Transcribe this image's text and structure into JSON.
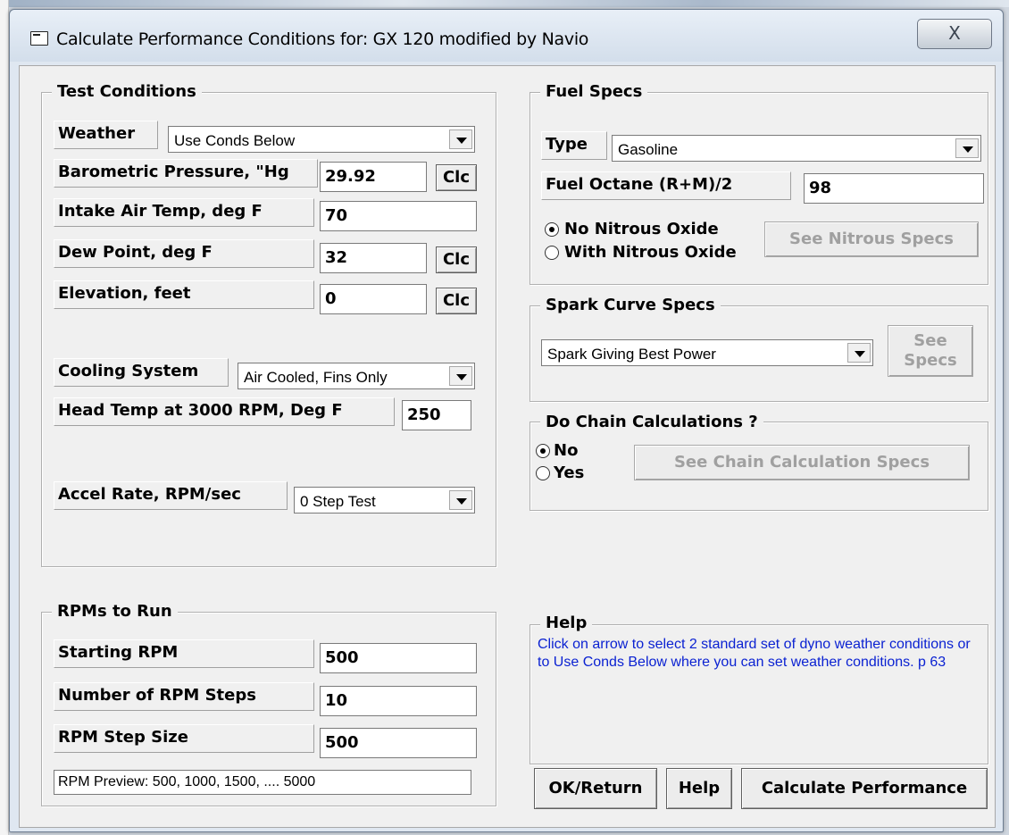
{
  "window": {
    "title": "Calculate Performance Conditions for: GX 120 modified by Navio",
    "close_label": "X"
  },
  "test_conditions": {
    "legend": "Test Conditions",
    "weather_label": "Weather",
    "weather_value": "Use Conds Below",
    "baro_label": "Barometric Pressure, \"Hg",
    "baro_value": "29.92",
    "intake_label": "Intake Air Temp, deg F",
    "intake_value": "70",
    "dew_label": "Dew Point, deg F",
    "dew_value": "32",
    "elev_label": "Elevation, feet",
    "elev_value": "0",
    "clc_label": "Clc",
    "cooling_label": "Cooling System",
    "cooling_value": "Air Cooled, Fins Only",
    "head_label": "Head Temp at 3000 RPM, Deg F",
    "head_value": "250",
    "accel_label": "Accel Rate, RPM/sec",
    "accel_value": "0 Step Test"
  },
  "rpms": {
    "legend": "RPMs to Run",
    "start_label": "Starting RPM",
    "start_value": "500",
    "steps_label": "Number of RPM Steps",
    "steps_value": "10",
    "stepsize_label": "RPM Step Size",
    "stepsize_value": "500",
    "preview": "RPM Preview: 500, 1000, 1500, .... 5000"
  },
  "fuel": {
    "legend": "Fuel Specs",
    "type_label": "Type",
    "type_value": "Gasoline",
    "octane_label": "Fuel Octane (R+M)/2",
    "octane_value": "98",
    "no_nitrous": "No Nitrous Oxide",
    "with_nitrous": "With Nitrous Oxide",
    "see_nitrous": "See Nitrous Specs"
  },
  "spark": {
    "legend": "Spark Curve Specs",
    "value": "Spark Giving Best Power",
    "see_line1": "See",
    "see_line2": "Specs"
  },
  "chain": {
    "legend": "Do Chain Calculations ?",
    "no": "No",
    "yes": "Yes",
    "see_chain": "See Chain Calculation Specs"
  },
  "help": {
    "legend": "Help",
    "text": "Click on arrow to select 2 standard set of dyno weather conditions or to Use Conds Below where you can set weather conditions.  p 63"
  },
  "buttons": {
    "ok": "OK/Return",
    "help": "Help",
    "calculate": "Calculate Performance"
  }
}
